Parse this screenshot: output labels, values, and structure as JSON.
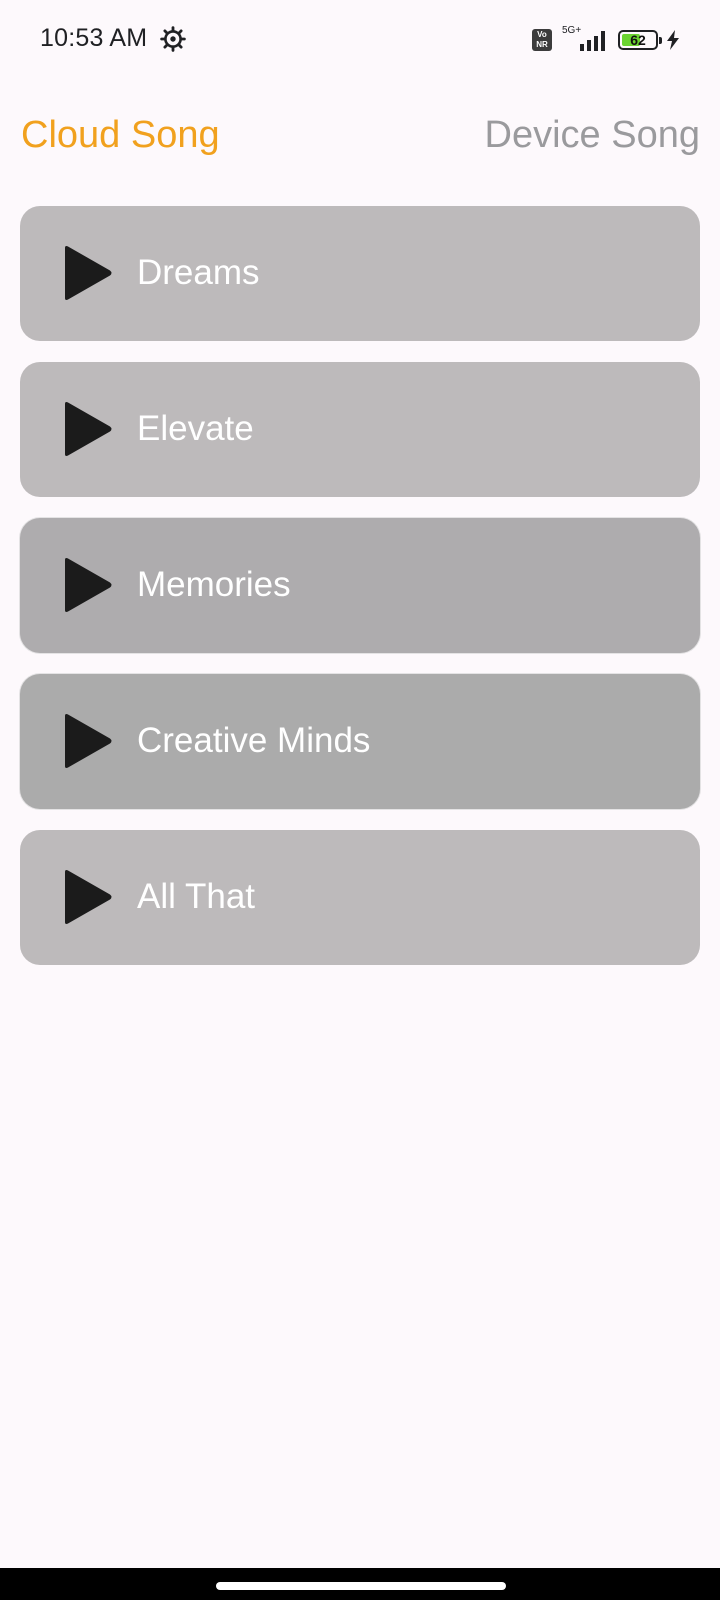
{
  "status_bar": {
    "time": "10:53 AM",
    "settings_icon": "gear-icon",
    "volte_label": "Vo NR",
    "network_label": "5G+",
    "signal_icon": "signal-bars-icon",
    "battery_level": "62",
    "battery_fraction": 0.62,
    "charging_icon": "bolt-icon"
  },
  "tabs": {
    "cloud": "Cloud Song",
    "device": "Device Song",
    "active": "cloud"
  },
  "colors": {
    "accent": "#f1a11e",
    "inactive_tab": "#9a9a9d",
    "card": "#bdbabb",
    "card_pressed": "#aeacae",
    "card_active": "#ababab",
    "play_icon": "#1b1b1b",
    "background": "#fdf9fc"
  },
  "songs": [
    {
      "title": "Dreams",
      "icon": "play-icon"
    },
    {
      "title": "Elevate",
      "icon": "play-icon"
    },
    {
      "title": "Memories",
      "icon": "play-icon"
    },
    {
      "title": "Creative Minds",
      "icon": "play-icon"
    },
    {
      "title": "All That",
      "icon": "play-icon"
    }
  ]
}
